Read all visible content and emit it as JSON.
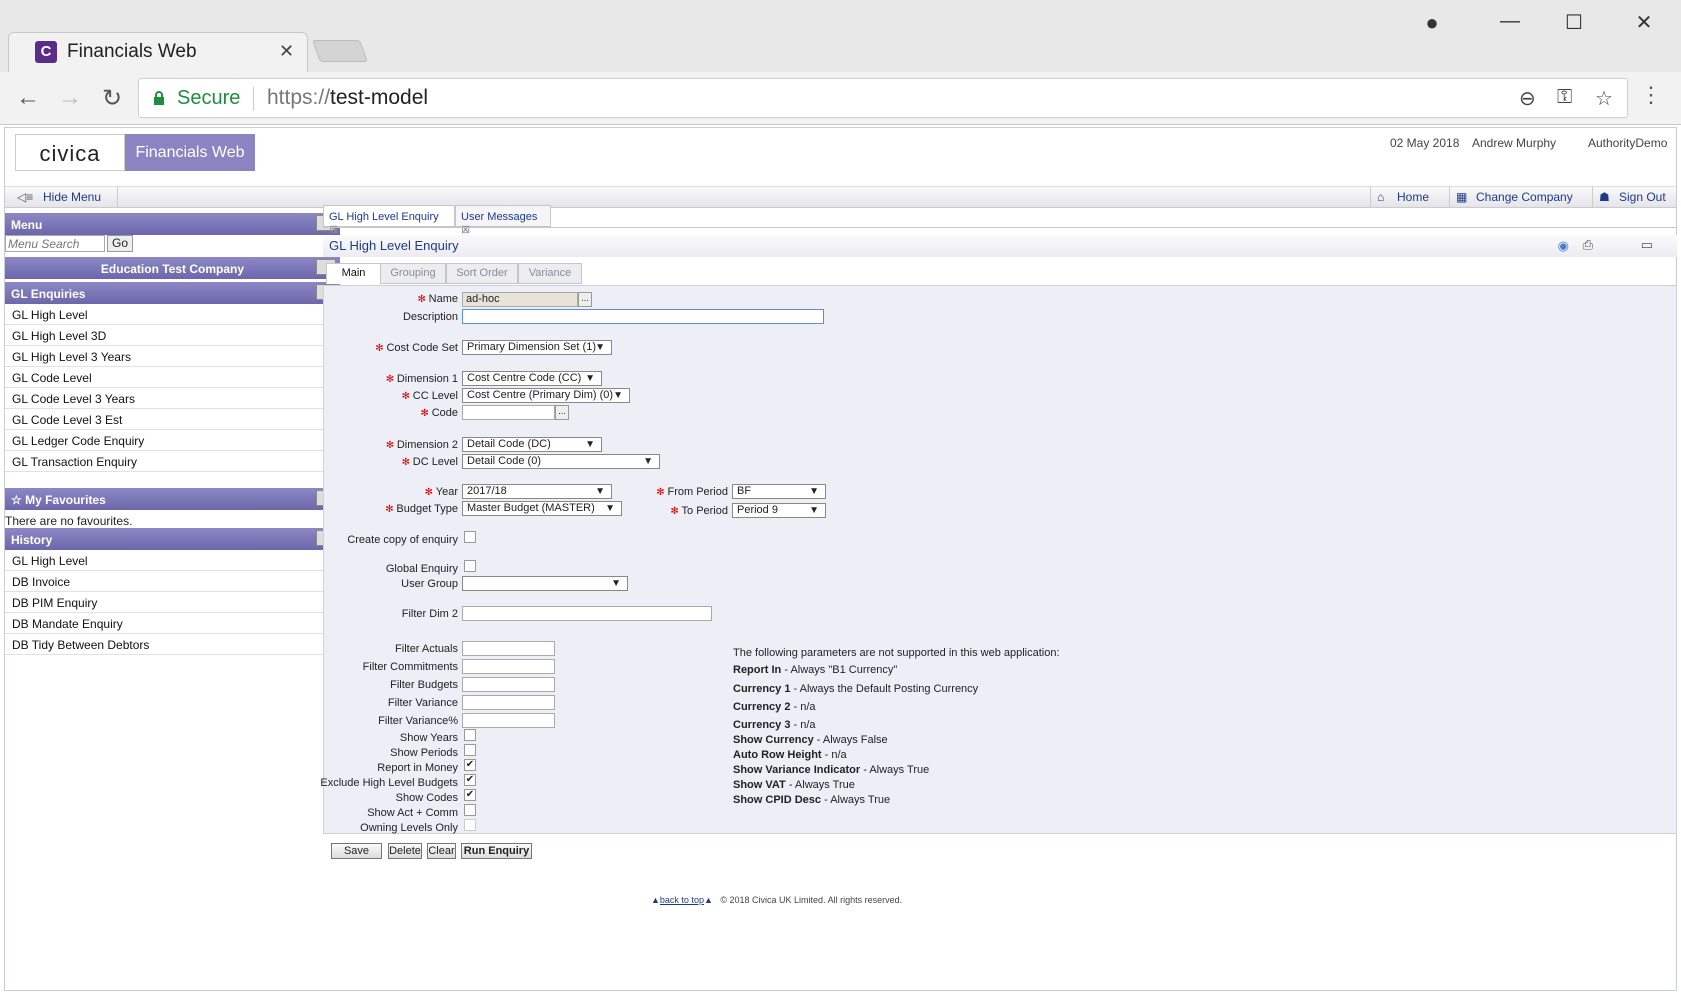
{
  "browser": {
    "tab_title": "Financials Web",
    "tab_icon_letter": "C",
    "secure_label": "Secure",
    "url_scheme": "https://",
    "url_host": "test-model"
  },
  "header": {
    "logo_text": "civica",
    "product_name": "Financials Web",
    "date": "02 May 2018",
    "user": "Andrew Murphy",
    "authority": "AuthorityDemo"
  },
  "toolbar": {
    "hide_menu": "Hide Menu",
    "home": "Home",
    "change_company": "Change Company",
    "sign_out": "Sign Out"
  },
  "sidebar": {
    "menu_title": "Menu",
    "search_placeholder": "Menu Search",
    "go_label": "Go",
    "company": "Education Test Company",
    "section_title": "GL Enquiries",
    "items": [
      "GL High Level",
      "GL High Level 3D",
      "GL High Level 3 Years",
      "GL Code Level",
      "GL Code Level 3 Years",
      "GL Code Level 3 Est",
      "GL Ledger Code Enquiry",
      "GL Transaction Enquiry"
    ],
    "favourites_title": "My Favourites",
    "favourites_empty": "There are no favourites.",
    "history_title": "History",
    "history_items": [
      "GL High Level",
      "DB Invoice",
      "DB PIM Enquiry",
      "DB Mandate Enquiry",
      "DB Tidy Between Debtors"
    ]
  },
  "content_tabs": [
    "GL High Level Enquiry",
    "User Messages"
  ],
  "page_title": "GL High Level Enquiry",
  "sub_tabs": [
    "Main",
    "Grouping",
    "Sort Order",
    "Variance"
  ],
  "form": {
    "name_label": "Name",
    "name_value": "ad-hoc",
    "description_label": "Description",
    "description_value": "",
    "cost_code_set_label": "Cost Code Set",
    "cost_code_set_value": "Primary Dimension Set (1)",
    "dimension1_label": "Dimension 1",
    "dimension1_value": "Cost Centre Code (CC)",
    "cc_level_label": "CC Level",
    "cc_level_value": "Cost Centre (Primary Dim) (0)",
    "code_label": "Code",
    "code_value": "",
    "dimension2_label": "Dimension 2",
    "dimension2_value": "Detail Code (DC)",
    "dc_level_label": "DC Level",
    "dc_level_value": "Detail Code (0)",
    "year_label": "Year",
    "year_value": "2017/18",
    "budget_type_label": "Budget Type",
    "budget_type_value": "Master Budget (MASTER)",
    "from_period_label": "From Period",
    "from_period_value": "BF",
    "to_period_label": "To Period",
    "to_period_value": "Period 9",
    "create_copy_label": "Create copy of enquiry",
    "global_enquiry_label": "Global Enquiry",
    "user_group_label": "User Group",
    "user_group_value": "",
    "filter_dim2_label": "Filter Dim 2",
    "filter_actuals_label": "Filter Actuals",
    "filter_commitments_label": "Filter Commitments",
    "filter_budgets_label": "Filter Budgets",
    "filter_variance_label": "Filter Variance",
    "filter_variance_pct_label": "Filter Variance%",
    "show_years_label": "Show Years",
    "show_periods_label": "Show Periods",
    "report_in_money_label": "Report in Money",
    "exclude_high_level_label": "Exclude High Level Budgets",
    "show_codes_label": "Show Codes",
    "show_act_comm_label": "Show Act + Comm",
    "owning_levels_label": "Owning Levels Only"
  },
  "checks": {
    "create_copy": false,
    "global_enquiry": false,
    "show_years": false,
    "show_periods": false,
    "report_in_money": true,
    "exclude_high_level": true,
    "show_codes": true,
    "show_act_comm": false,
    "owning_levels": false
  },
  "unsupported": {
    "intro": "The following parameters are not supported in this web application:",
    "rows": [
      {
        "k": "Report In",
        "v": " - Always \"B1 Currency\""
      },
      {
        "k": "Currency 1",
        "v": " - Always the Default Posting Currency"
      },
      {
        "k": "Currency 2",
        "v": " - n/a"
      },
      {
        "k": "Currency 3",
        "v": " - n/a"
      },
      {
        "k": "Show Currency",
        "v": " - Always False"
      },
      {
        "k": "Auto Row Height",
        "v": " - n/a"
      },
      {
        "k": "Show Variance Indicator",
        "v": " - Always True"
      },
      {
        "k": "Show VAT",
        "v": " - Always True"
      },
      {
        "k": "Show CPID Desc",
        "v": " - Always True"
      }
    ]
  },
  "buttons": {
    "save": "Save",
    "delete": "Delete",
    "clear": "Clear",
    "run": "Run Enquiry"
  },
  "footer": {
    "back_to_top": "back to top",
    "copyright": "© 2018 Civica UK Limited. All rights reserved."
  },
  "colors": {
    "accent": "#6b67ab",
    "link": "#1d3b8a",
    "required": "#dd0000"
  }
}
